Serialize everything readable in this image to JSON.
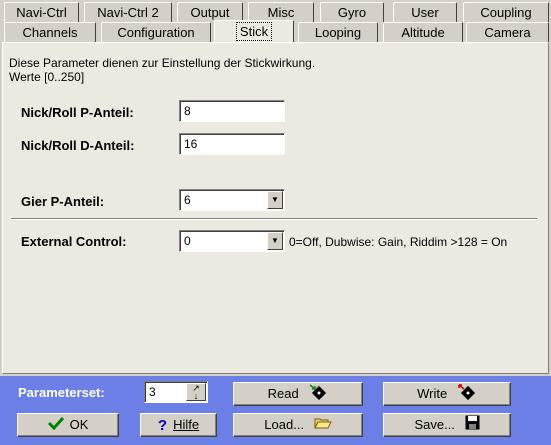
{
  "tabs": {
    "row1": [
      "Navi-Ctrl",
      "Navi-Ctrl 2",
      "Output",
      "Misc",
      "Gyro",
      "User",
      "Coupling"
    ],
    "row2": [
      "Channels",
      "Configuration",
      "Stick",
      "Looping",
      "Altitude",
      "Camera"
    ],
    "active": "Stick"
  },
  "panel": {
    "description_line1": "Diese Parameter dienen zur Einstellung der Stickwirkung.",
    "description_line2": "Werte [0..250]",
    "nick_p": {
      "label": "Nick/Roll P-Anteil:",
      "value": "8"
    },
    "nick_d": {
      "label": "Nick/Roll D-Anteil:",
      "value": "16"
    },
    "gier_p": {
      "label": "Gier P-Anteil:",
      "value": "6"
    },
    "external": {
      "label": "External Control:",
      "value": "0",
      "hint": "0=Off, Dubwise: Gain, Riddim >128 = On"
    }
  },
  "footer": {
    "parameterset_label": "Parameterset:",
    "parameterset_value": "3",
    "read_label": "Read",
    "write_label": "Write",
    "ok_label": "OK",
    "hilfe_label": "Hilfe",
    "load_label": "Load...",
    "save_label": "Save...",
    "bg_color": "#6c7fe6"
  }
}
